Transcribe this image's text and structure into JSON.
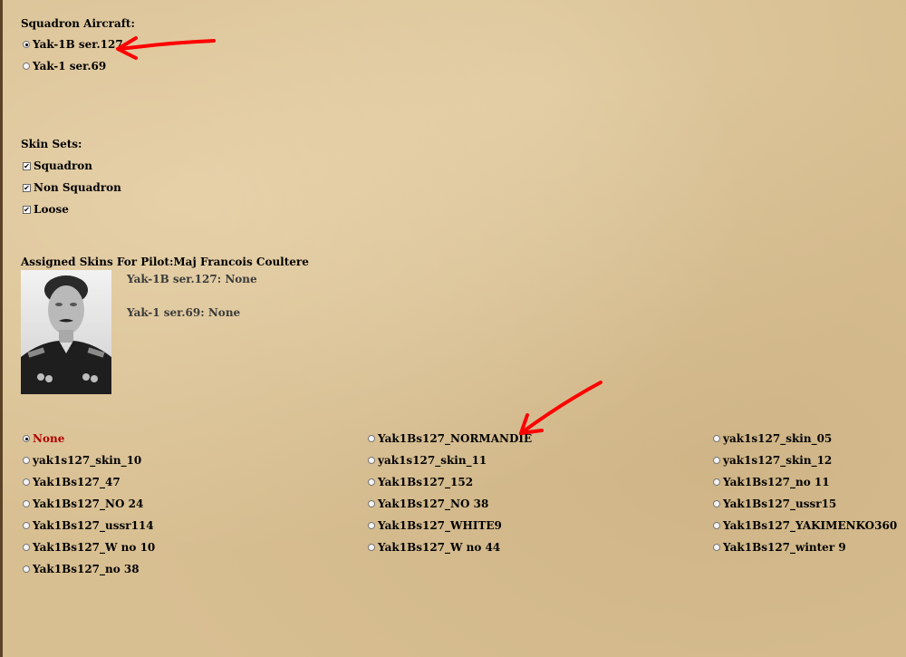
{
  "squadron_aircraft": {
    "title": "Squadron Aircraft:",
    "options": [
      {
        "label": "Yak-1B ser.127",
        "selected": true
      },
      {
        "label": "Yak-1 ser.69",
        "selected": false
      }
    ]
  },
  "skin_sets": {
    "title": "Skin Sets:",
    "options": [
      {
        "label": "Squadron",
        "checked": true
      },
      {
        "label": "Non Squadron",
        "checked": true
      },
      {
        "label": "Loose",
        "checked": true
      }
    ]
  },
  "assigned": {
    "title": "Assigned Skins For Pilot:Maj Francois Coultere",
    "lines": [
      "Yak-1B ser.127: None",
      "Yak-1 ser.69: None"
    ]
  },
  "skins": {
    "col1": [
      "None",
      "yak1s127_skin_10",
      "Yak1Bs127_47",
      "Yak1Bs127_NO 24",
      "Yak1Bs127_ussr114",
      "Yak1Bs127_W no 10",
      "Yak1Bs127_no 38"
    ],
    "col2": [
      "Yak1Bs127_NORMANDIE",
      "yak1s127_skin_11",
      "Yak1Bs127_152",
      "Yak1Bs127_NO 38",
      "Yak1Bs127_WHITE9",
      "Yak1Bs127_W no 44"
    ],
    "col3": [
      "yak1s127_skin_05",
      "yak1s127_skin_12",
      "Yak1Bs127_no 11",
      "Yak1Bs127_ussr15",
      "Yak1Bs127_YAKIMENKO360",
      "Yak1Bs127_winter 9"
    ],
    "selected": "None"
  },
  "colors": {
    "selected_text": "#b00000",
    "annotation": "#ff0000"
  }
}
